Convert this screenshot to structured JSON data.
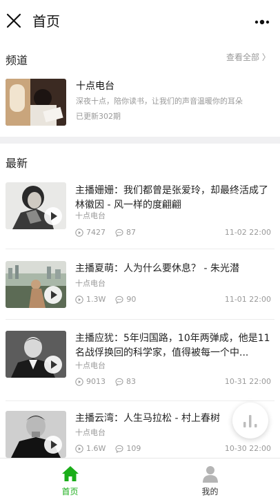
{
  "header": {
    "title": "首页"
  },
  "channels": {
    "section_title": "频道",
    "view_all": "查看全部",
    "item": {
      "title": "十点电台",
      "description": "深夜十点，陪你读书，让我们的声音温暖你的耳朵",
      "updated": "已更新302期"
    }
  },
  "latest": {
    "section_title": "最新",
    "articles": [
      {
        "title": "主播姗姗：我们都曾是张爱玲，却最终活成了林徽因 - 风一样的度翩翩",
        "source": "十点电台",
        "plays": "7427",
        "comments": "87",
        "time": "11-02 22:00"
      },
      {
        "title": "主播夏萌：人为什么要休息？ - 朱光潜",
        "source": "十点电台",
        "plays": "1.3W",
        "comments": "90",
        "time": "11-01 22:00"
      },
      {
        "title": "主播应犹：5年归国路，10年两弹成，他是11名战俘换回的科学家，值得被每一个中...",
        "source": "十点电台",
        "plays": "9013",
        "comments": "83",
        "time": "10-31 22:00"
      },
      {
        "title": "主播云湾：人生马拉松 - 村上春树",
        "source": "十点电台",
        "plays": "1.6W",
        "comments": "109",
        "time": "10-30 22:00"
      }
    ]
  },
  "tabbar": {
    "home_label": "首页",
    "mine_label": "我的"
  },
  "colors": {
    "accent": "#1aad19",
    "secondary_text": "#999999"
  }
}
